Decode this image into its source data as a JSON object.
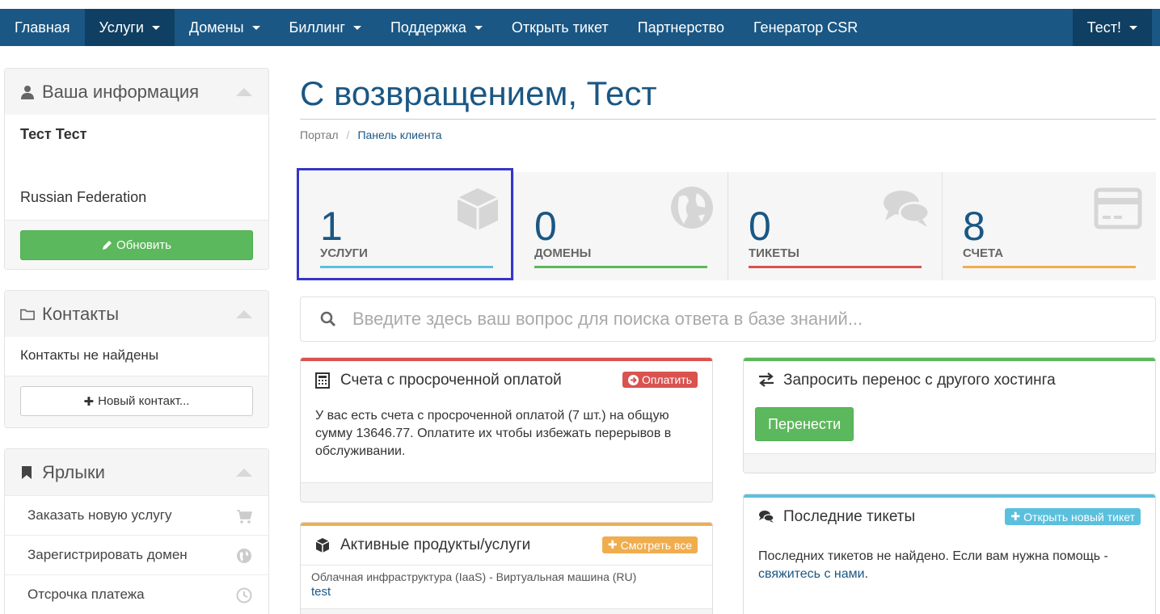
{
  "nav": {
    "home": "Главная",
    "services": "Услуги",
    "domains": "Домены",
    "billing": "Биллинг",
    "support": "Поддержка",
    "open_ticket": "Открыть тикет",
    "affiliates": "Партнерство",
    "csr": "Генератор CSR",
    "account": "Тест!"
  },
  "sidebar": {
    "info": {
      "title": "Ваша информация",
      "name": "Тест Тест",
      "country": "Russian Federation",
      "update_button": "Обновить"
    },
    "contacts": {
      "title": "Контакты",
      "empty": "Контакты не найдены",
      "new_button": "Новый контакт..."
    },
    "shortcuts": {
      "title": "Ярлыки",
      "items": [
        {
          "label": "Заказать новую услугу",
          "icon": "cart-icon"
        },
        {
          "label": "Зарегистрировать домен",
          "icon": "globe-icon"
        },
        {
          "label": "Отсрочка платежа",
          "icon": "clock-icon"
        }
      ]
    }
  },
  "main": {
    "title": "С возвращением, Тест",
    "breadcrumb": [
      "Портал",
      "Панель клиента"
    ],
    "tiles": [
      {
        "count": "1",
        "label": "УСЛУГИ",
        "color": "#5bc0de",
        "icon": "cube-icon"
      },
      {
        "count": "0",
        "label": "ДОМЕНЫ",
        "color": "#5cb85c",
        "icon": "globe-icon"
      },
      {
        "count": "0",
        "label": "ТИКЕТЫ",
        "color": "#d9534f",
        "icon": "comments-icon"
      },
      {
        "count": "8",
        "label": "СЧЕТА",
        "color": "#f0ad4e",
        "icon": "credit-card-icon"
      }
    ],
    "search_placeholder": "Введите здесь ваш вопрос для поиска ответа в базе знаний..."
  },
  "cards": {
    "overdue": {
      "title": "Счета с просроченной оплатой",
      "button": "Оплатить",
      "text": "У вас есть счета с просроченной оплатой (7 шт.) на общую сумму 13646.77. Оплатите их чтобы избежать перерывов в обслуживании."
    },
    "transfer": {
      "title": "Запросить перенос с другого хостинга",
      "button": "Перенести"
    },
    "products": {
      "title": "Активные продукты/услуги",
      "button": "Смотреть все",
      "item_desc": "Облачная инфраструктура (IaaS) - Виртуальная машина (RU)",
      "item_name": "test"
    },
    "tickets": {
      "title": "Последние тикеты",
      "button": "Открыть новый тикет",
      "text": "Последних тикетов не найдено. Если вам нужна помощь -",
      "link": "свяжитесь с нами",
      "link_suffix": "."
    }
  },
  "colors": {
    "brand": "#1a5784",
    "green": "#5cb85c",
    "red": "#d9534f",
    "orange": "#f0ad4e",
    "cyan": "#5bc0de"
  }
}
